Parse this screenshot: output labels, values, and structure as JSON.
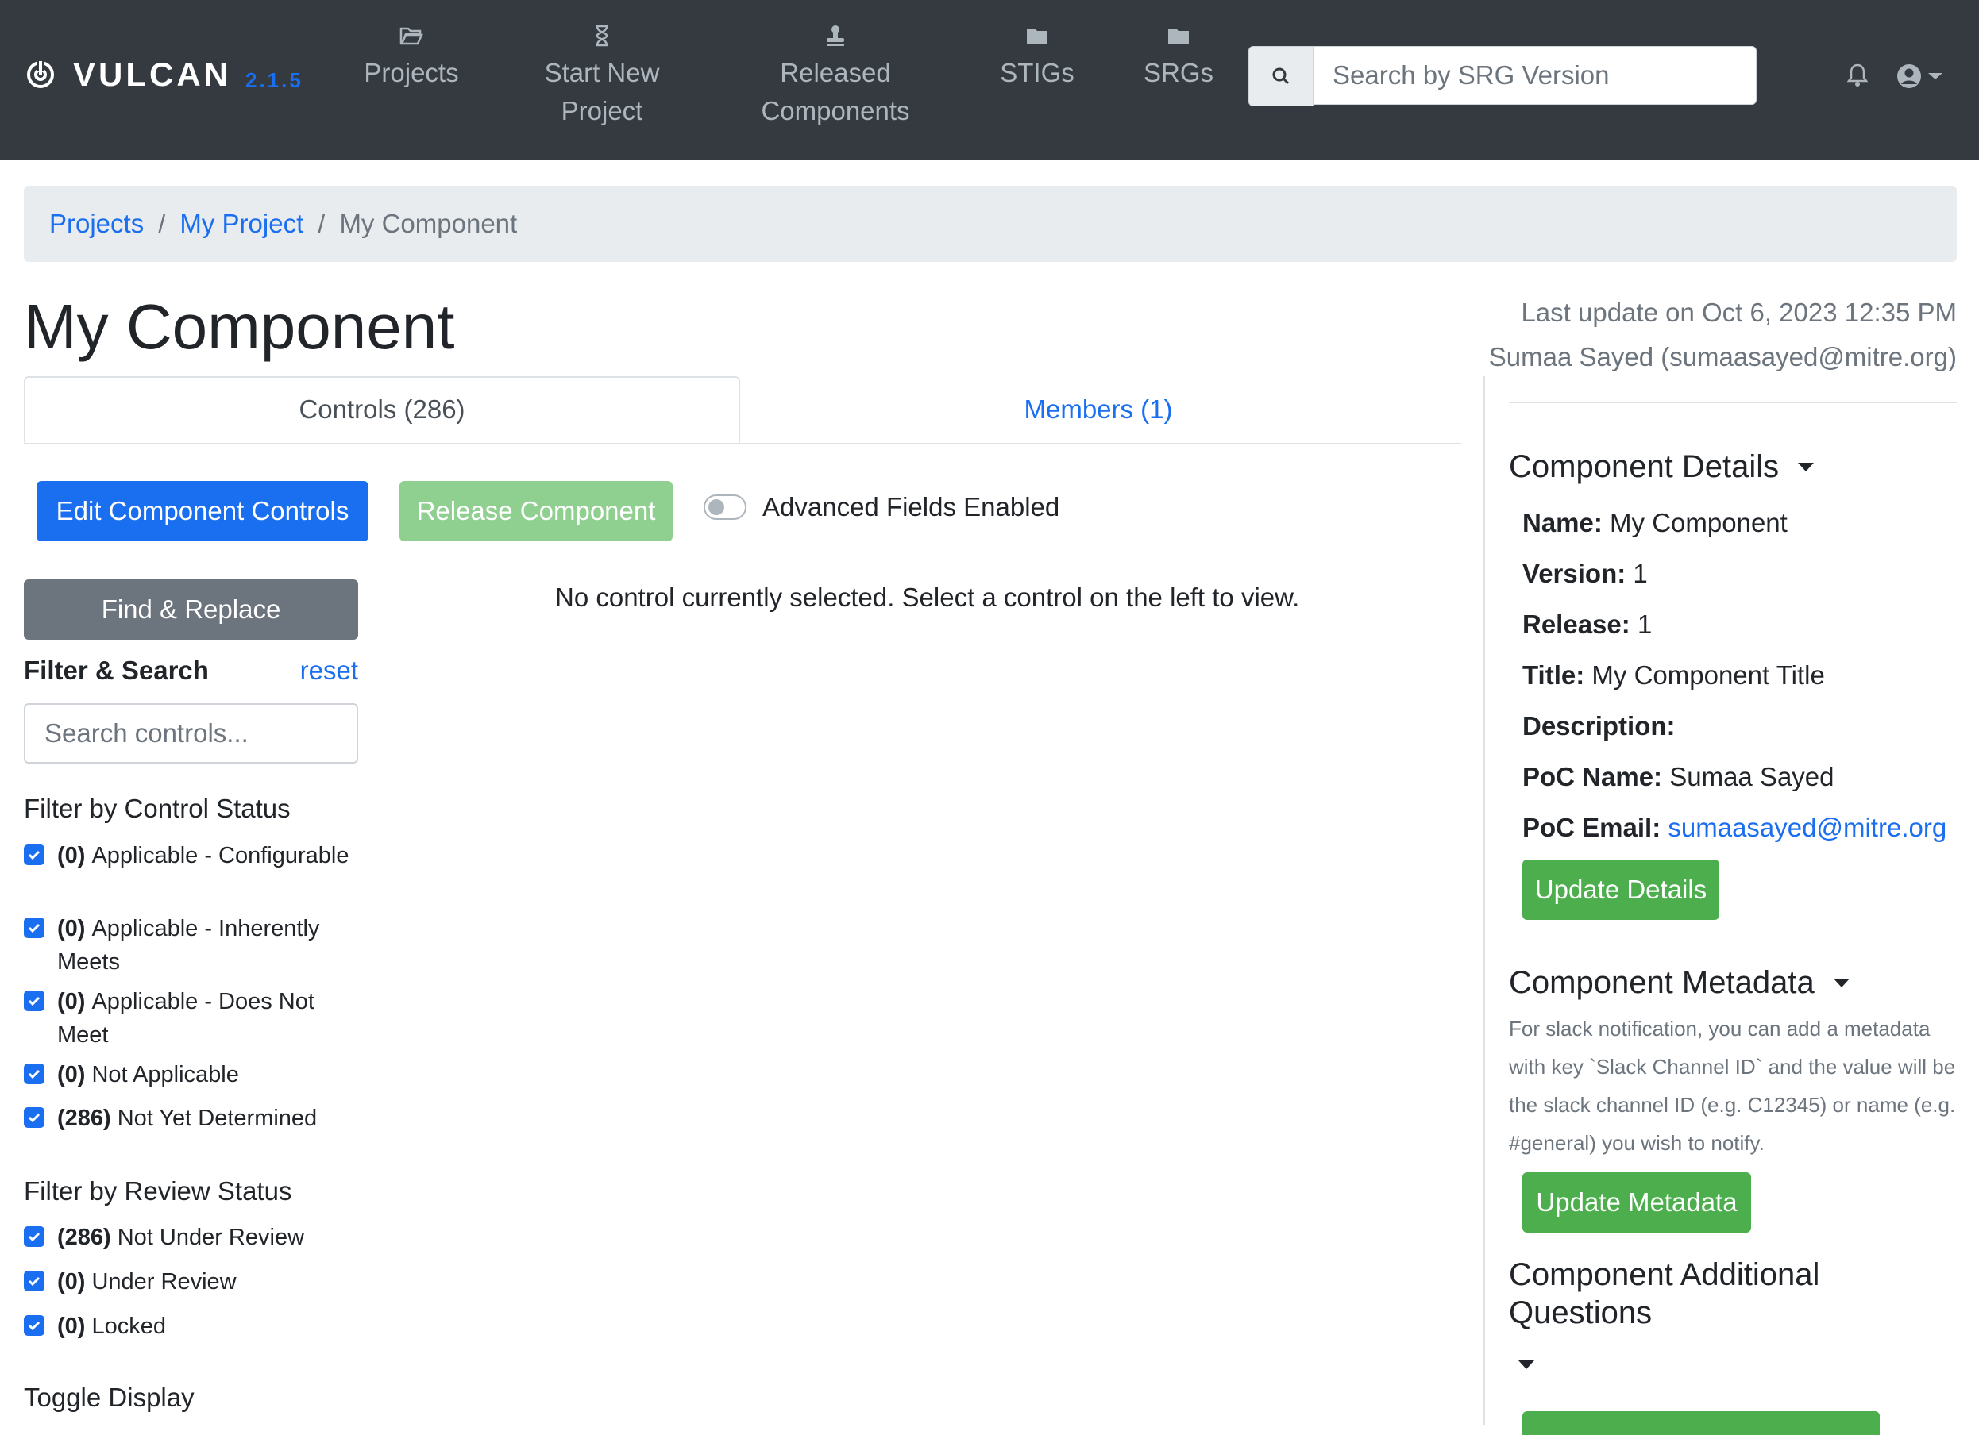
{
  "navbar": {
    "brand": "VULCAN",
    "version": "2.1.5",
    "items": [
      {
        "label_lines": [
          "Projects"
        ],
        "icon": "folder-open-icon"
      },
      {
        "label_lines": [
          "Start New",
          "Project"
        ],
        "icon": "hourglass-icon"
      },
      {
        "label_lines": [
          "Released",
          "Components"
        ],
        "icon": "stamp-icon"
      },
      {
        "label_lines": [
          "STIGs"
        ],
        "icon": "folder-icon"
      },
      {
        "label_lines": [
          "SRGs"
        ],
        "icon": "folder-icon"
      }
    ],
    "search_placeholder": "Search by SRG Version"
  },
  "breadcrumb": {
    "items": [
      "Projects",
      "My Project"
    ],
    "current": "My Component"
  },
  "page": {
    "title": "My Component",
    "last_update": "Last update on Oct 6, 2023 12:35 PM",
    "last_update_by": "Sumaa Sayed (sumaasayed@mitre.org)"
  },
  "tabs": {
    "controls": "Controls (286)",
    "members": "Members (1)"
  },
  "actions": {
    "edit": "Edit Component Controls",
    "release": "Release Component",
    "advanced": "Advanced Fields Enabled",
    "find_replace": "Find & Replace"
  },
  "filter": {
    "title": "Filter & Search",
    "reset": "reset",
    "search_placeholder": "Search controls...",
    "control_status_title": "Filter by Control Status",
    "control_status": [
      {
        "count": "(0)",
        "label": "Applicable - Configurable"
      },
      {
        "count": "(0)",
        "label": "Applicable - Inherently Meets"
      },
      {
        "count": "(0)",
        "label": "Applicable - Does Not Meet"
      },
      {
        "count": "(0)",
        "label": "Not Applicable"
      },
      {
        "count": "(286)",
        "label": "Not Yet Determined"
      }
    ],
    "review_status_title": "Filter by Review Status",
    "review_status": [
      {
        "count": "(286)",
        "label": "Not Under Review"
      },
      {
        "count": "(0)",
        "label": "Under Review"
      },
      {
        "count": "(0)",
        "label": "Locked"
      }
    ],
    "toggle_display": "Toggle Display"
  },
  "empty_message": "No control currently selected. Select a control on the left to view.",
  "details": {
    "title": "Component Details",
    "name_label": "Name:",
    "name": "My Component",
    "version_label": "Version:",
    "version": "1",
    "release_label": "Release:",
    "release": "1",
    "title_label": "Title:",
    "title_value": "My Component Title",
    "description_label": "Description:",
    "poc_name_label": "PoC Name:",
    "poc_name": "Sumaa Sayed",
    "poc_email_label": "PoC Email:",
    "poc_email": "sumaasayed@mitre.org",
    "update_button": "Update Details"
  },
  "metadata": {
    "title": "Component Metadata",
    "note": "For slack notification, you can add a metadata with key `Slack Channel ID` and the value will be the slack channel ID (e.g. C12345) or name (e.g. #general) you wish to notify.",
    "update_button": "Update Metadata"
  },
  "additional_questions": {
    "title": "Component Additional Questions"
  },
  "colors": {
    "navbar": "#343a40",
    "primary": "#1a6ef0",
    "success": "#4cae4c",
    "secondary": "#6c757d"
  }
}
